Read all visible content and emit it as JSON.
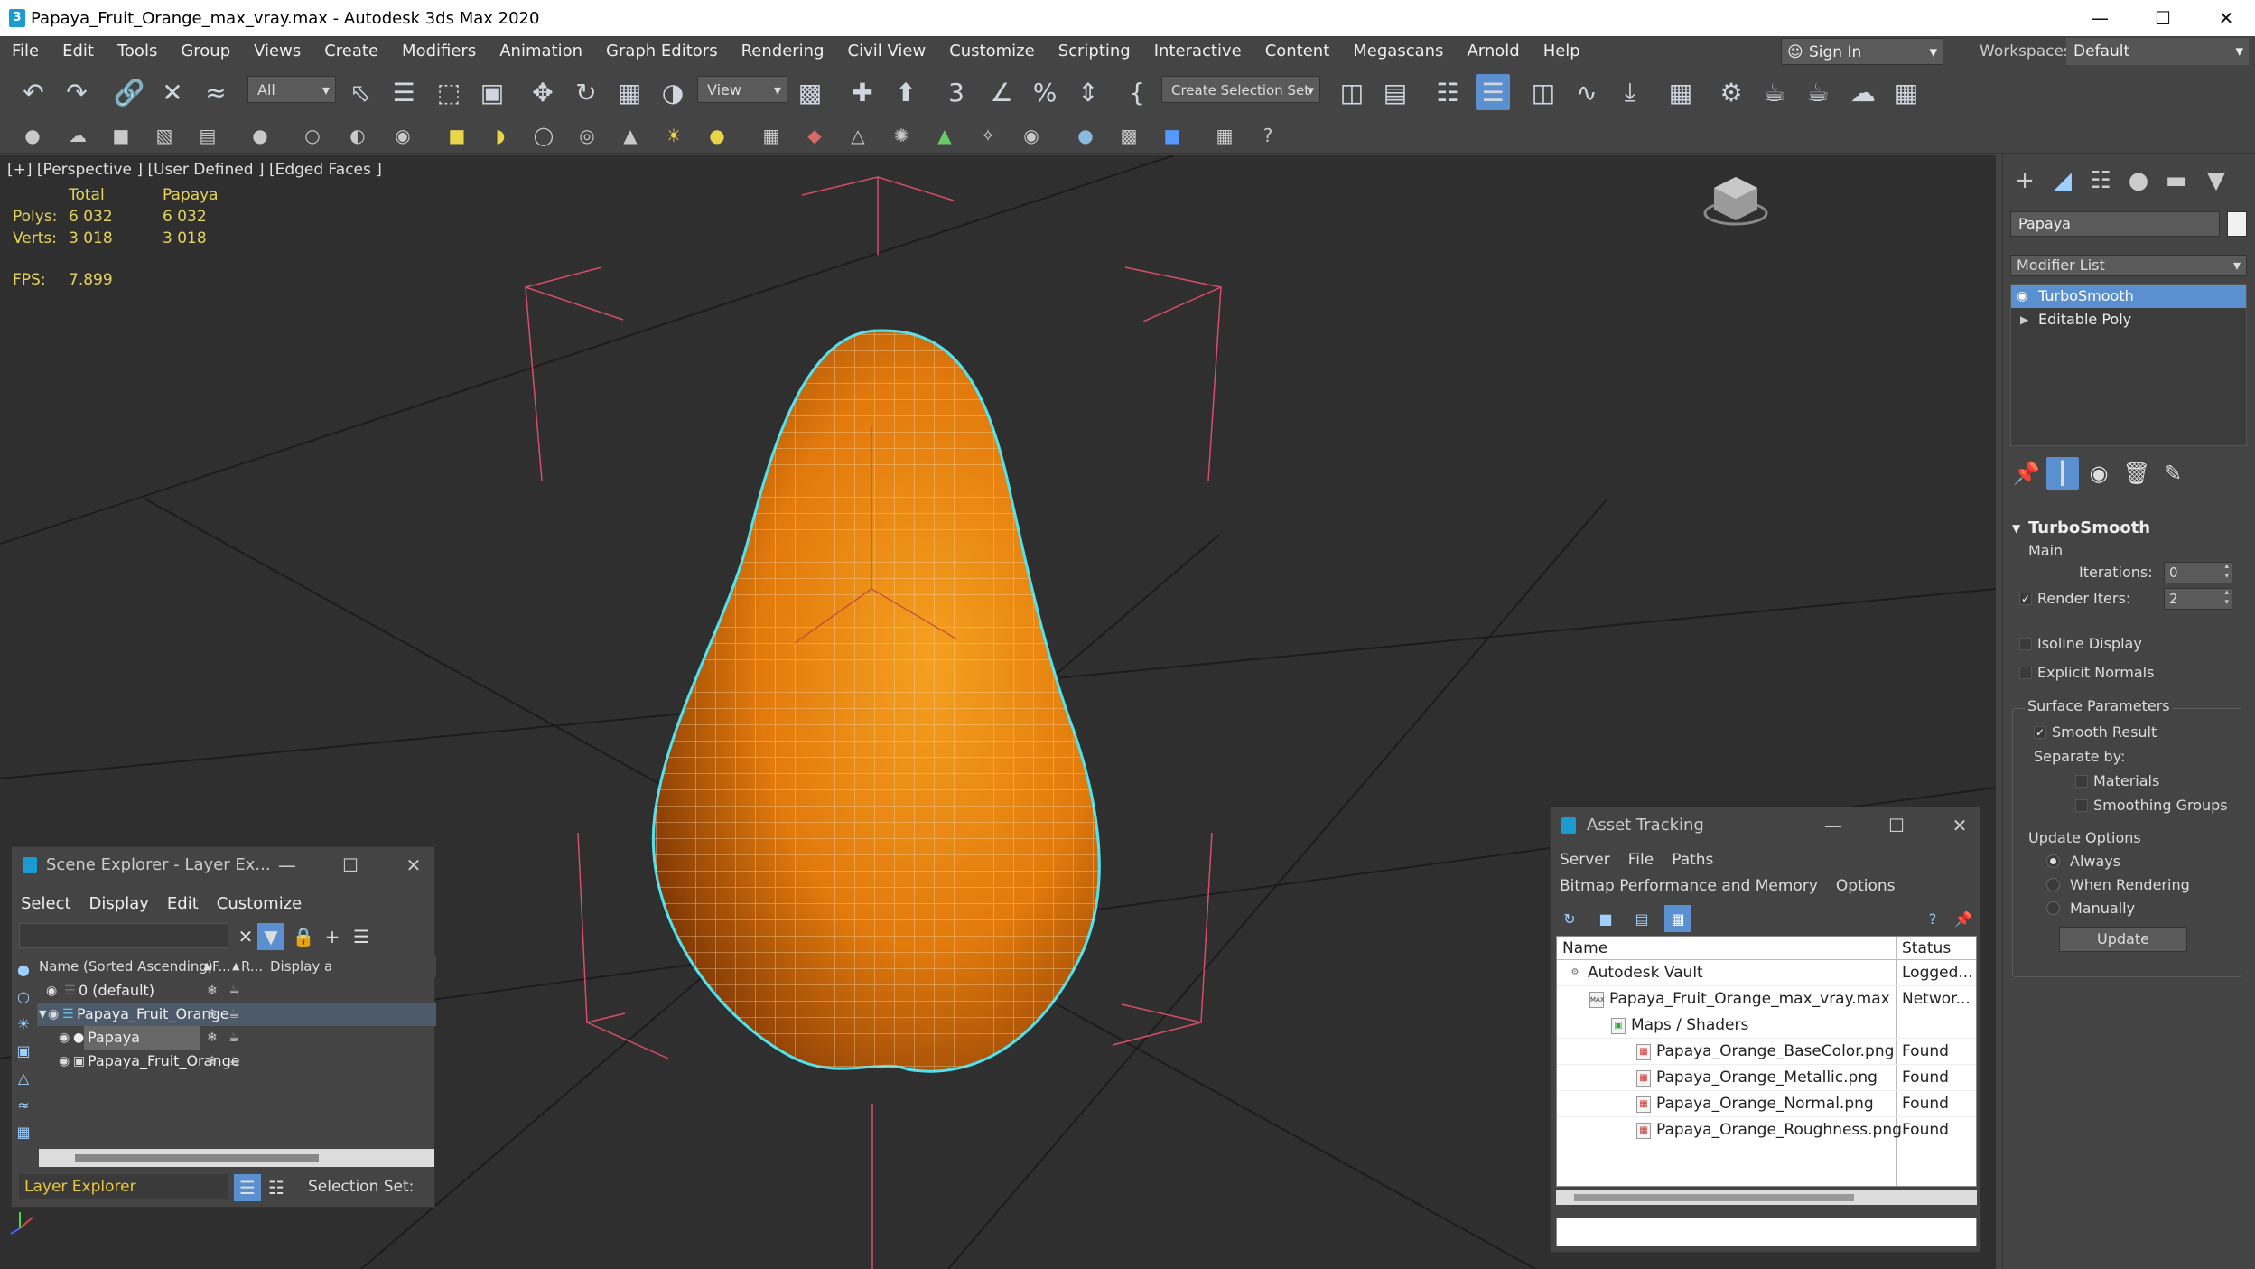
{
  "window": {
    "title": "Papaya_Fruit_Orange_max_vray.max - Autodesk 3ds Max 2020",
    "app_icon": "3"
  },
  "menu": [
    "File",
    "Edit",
    "Tools",
    "Group",
    "Views",
    "Create",
    "Modifiers",
    "Animation",
    "Graph Editors",
    "Rendering",
    "Civil View",
    "Customize",
    "Scripting",
    "Interactive",
    "Content",
    "Megascans",
    "Arnold",
    "Help"
  ],
  "account": {
    "sign_in": "Sign In",
    "workspaces_label": "Workspaces:",
    "workspace": "Default"
  },
  "toolbar": {
    "filter": "All",
    "ref_coord": "View",
    "selection_set": "Create Selection Set"
  },
  "viewport": {
    "label": "[+] [Perspective ] [User Defined ] [Edged Faces ]",
    "stats": {
      "col_total": "Total",
      "col_object": "Papaya",
      "polys_label": "Polys:",
      "polys_total": "6 032",
      "polys_obj": "6 032",
      "verts_label": "Verts:",
      "verts_total": "3 018",
      "verts_obj": "3 018",
      "fps_label": "FPS:",
      "fps": "7.899"
    },
    "mesh_color": "#e8830f",
    "selection_outline": "#4fe3f0"
  },
  "command_panel": {
    "object_name": "Papaya",
    "modifier_list": "Modifier List",
    "stack": [
      "TurboSmooth",
      "Editable Poly"
    ],
    "turbosmooth": {
      "title": "TurboSmooth",
      "main": "Main",
      "iterations_label": "Iterations:",
      "iterations": "0",
      "render_iters_label": "Render Iters:",
      "render_iters": "2",
      "isoline": "Isoline Display",
      "explicit_normals": "Explicit Normals",
      "surface_params": "Surface Parameters",
      "smooth_result": "Smooth Result",
      "separate_by": "Separate by:",
      "materials": "Materials",
      "smoothing_groups": "Smoothing Groups",
      "update_options": "Update Options",
      "always": "Always",
      "when_rendering": "When Rendering",
      "manually": "Manually",
      "update_btn": "Update"
    }
  },
  "scene_explorer": {
    "title": "Scene Explorer - Layer Ex...",
    "menu": [
      "Select",
      "Display",
      "Edit",
      "Customize"
    ],
    "columns": {
      "name": "Name (Sorted Ascending)",
      "frozen": "F...",
      "render": "R...",
      "display": "Display a"
    },
    "rows": [
      "0 (default)",
      "Papaya_Fruit_Orange",
      "Papaya",
      "Papaya_Fruit_Orange"
    ],
    "bottom_mode": "Layer Explorer",
    "selection_set_label": "Selection Set:"
  },
  "asset_tracking": {
    "title": "Asset Tracking",
    "menu1": [
      "Server",
      "File",
      "Paths"
    ],
    "menu2": [
      "Bitmap Performance and Memory",
      "Options"
    ],
    "col_name": "Name",
    "col_status": "Status",
    "rows": [
      {
        "name": "Autodesk Vault",
        "status": "Logged..."
      },
      {
        "name": "Papaya_Fruit_Orange_max_vray.max",
        "status": "Networ..."
      },
      {
        "name": "Maps / Shaders",
        "status": ""
      },
      {
        "name": "Papaya_Orange_BaseColor.png",
        "status": "Found"
      },
      {
        "name": "Papaya_Orange_Metallic.png",
        "status": "Found"
      },
      {
        "name": "Papaya_Orange_Normal.png",
        "status": "Found"
      },
      {
        "name": "Papaya_Orange_Roughness.png",
        "status": "Found"
      }
    ]
  }
}
